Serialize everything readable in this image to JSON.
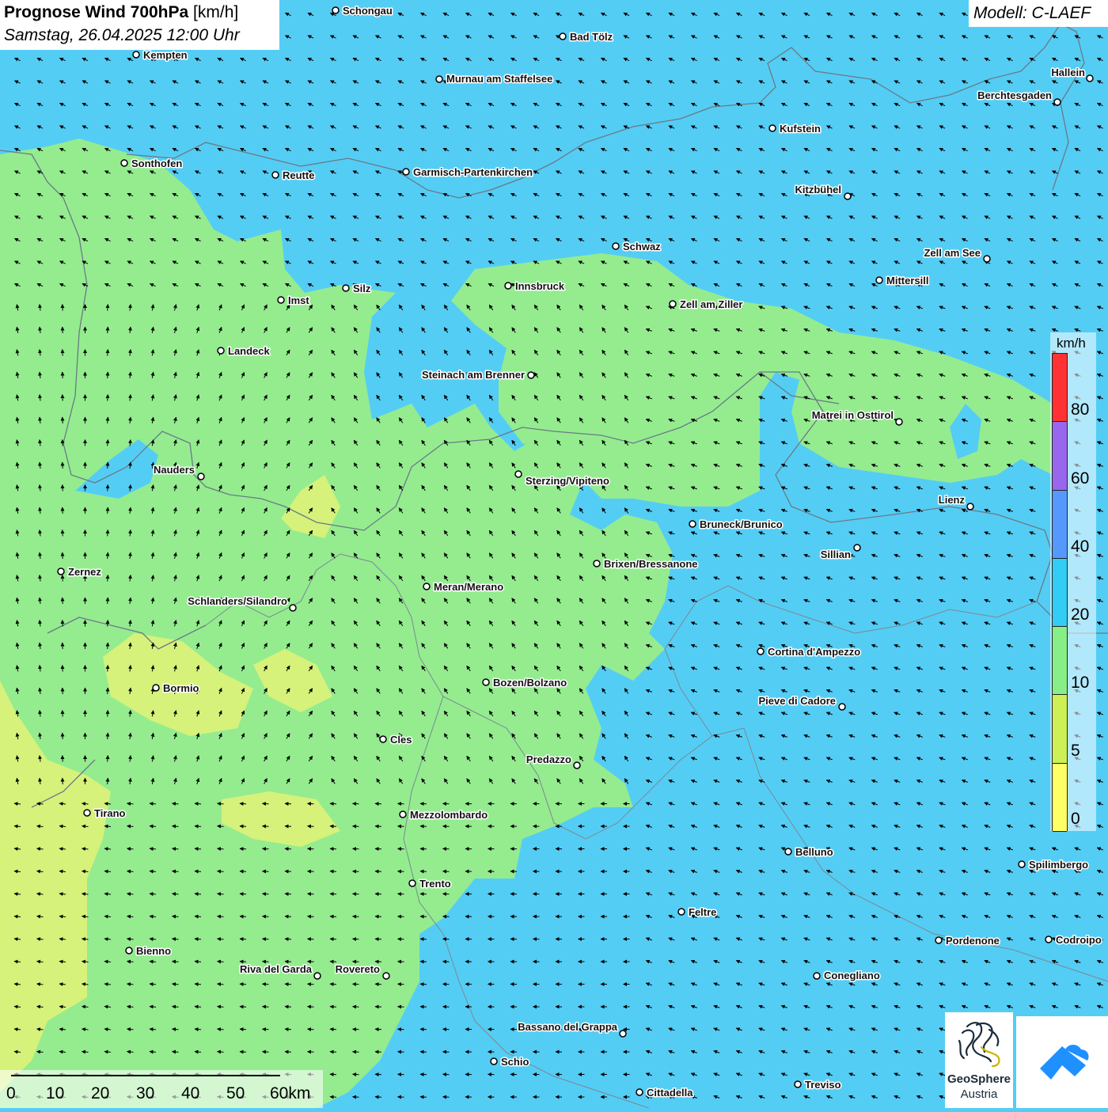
{
  "title": {
    "main": "Prognose Wind 700hPa",
    "unit": "[km/h]",
    "datetime": "Samstag, 26.04.2025 12:00 Uhr"
  },
  "model_label": "Modell: C-LAEF",
  "legend": {
    "unit": "km/h",
    "ticks": [
      "80",
      "60",
      "40",
      "20",
      "10",
      "5",
      "0"
    ],
    "colors": [
      "#ff3333",
      "#9966ee",
      "#5599ff",
      "#33ccf5",
      "#88ee88",
      "#ccf055",
      "#ffff66"
    ]
  },
  "scalebar": {
    "labels": [
      "0",
      "10",
      "20",
      "30",
      "40",
      "50",
      "60km"
    ]
  },
  "logos": {
    "geosphere_line1": "GeoSphere",
    "geosphere_line2": "Austria"
  },
  "cities": [
    {
      "name": "Schongau"
    },
    {
      "name": "Bad Tölz"
    },
    {
      "name": "Kempten"
    },
    {
      "name": "Murnau am Staffelsee"
    },
    {
      "name": "Hallein"
    },
    {
      "name": "Berchtesgaden"
    },
    {
      "name": "Kufstein"
    },
    {
      "name": "Sonthofen"
    },
    {
      "name": "Reutte"
    },
    {
      "name": "Garmisch-Partenkirchen"
    },
    {
      "name": "Kitzbühel"
    },
    {
      "name": "Schwaz"
    },
    {
      "name": "Zell am See"
    },
    {
      "name": "Mittersill"
    },
    {
      "name": "Innsbruck"
    },
    {
      "name": "Silz"
    },
    {
      "name": "Imst"
    },
    {
      "name": "Zell am Ziller"
    },
    {
      "name": "Landeck"
    },
    {
      "name": "Steinach am Brenner"
    },
    {
      "name": "Matrei in Osttirol"
    },
    {
      "name": "Nauders"
    },
    {
      "name": "Sterzing/Vipiteno"
    },
    {
      "name": "Lienz"
    },
    {
      "name": "Bruneck/Brunico"
    },
    {
      "name": "Sillian"
    },
    {
      "name": "Brixen/Bressanone"
    },
    {
      "name": "Zernez"
    },
    {
      "name": "Meran/Merano"
    },
    {
      "name": "Schlanders/Silandro"
    },
    {
      "name": "Cortina d'Ampezzo"
    },
    {
      "name": "Bormio"
    },
    {
      "name": "Bozen/Bolzano"
    },
    {
      "name": "Pieve di Cadore"
    },
    {
      "name": "Cles"
    },
    {
      "name": "Predazzo"
    },
    {
      "name": "Tirano"
    },
    {
      "name": "Mezzolombardo"
    },
    {
      "name": "Belluno"
    },
    {
      "name": "Spilimbergo"
    },
    {
      "name": "Trento"
    },
    {
      "name": "Feltre"
    },
    {
      "name": "Pordenone"
    },
    {
      "name": "Codroipo"
    },
    {
      "name": "Bienno"
    },
    {
      "name": "Riva del Garda"
    },
    {
      "name": "Rovereto"
    },
    {
      "name": "Conegliano"
    },
    {
      "name": "Bassano del Grappa"
    },
    {
      "name": "Schio"
    },
    {
      "name": "Treviso"
    },
    {
      "name": "Cittadella"
    }
  ]
}
